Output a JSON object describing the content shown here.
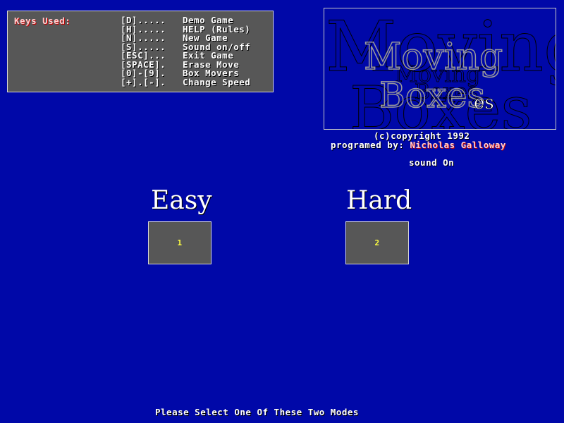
{
  "keys": {
    "title": "Keys Used:",
    "items": [
      {
        "key": "[D].....",
        "action": "Demo Game"
      },
      {
        "key": "[H].....",
        "action": "HELP (Rules)"
      },
      {
        "key": "[N].....",
        "action": "New Game"
      },
      {
        "key": "[S].....",
        "action": "Sound on/off"
      },
      {
        "key": "[ESC]...",
        "action": "Exit Game"
      },
      {
        "key": "[SPACE].",
        "action": "Erase Move"
      },
      {
        "key": "[0]-[9].",
        "action": "Box Movers"
      },
      {
        "key": "[+].[-].",
        "action": "Change Speed"
      }
    ]
  },
  "logo": {
    "line1": "Moving",
    "line2": "Boxes"
  },
  "credits": {
    "copyright": "(c)copyright  1992",
    "programed_by_label": "programed by:",
    "author": "Nicholas Galloway",
    "sound_status": "sound On"
  },
  "modes": [
    {
      "label": "Easy",
      "number": "1"
    },
    {
      "label": "Hard",
      "number": "2"
    }
  ],
  "prompt": "Please Select One Of These Two Modes",
  "colors": {
    "background": "#0008a8",
    "panel": "#575757",
    "number": "#ffff40"
  }
}
